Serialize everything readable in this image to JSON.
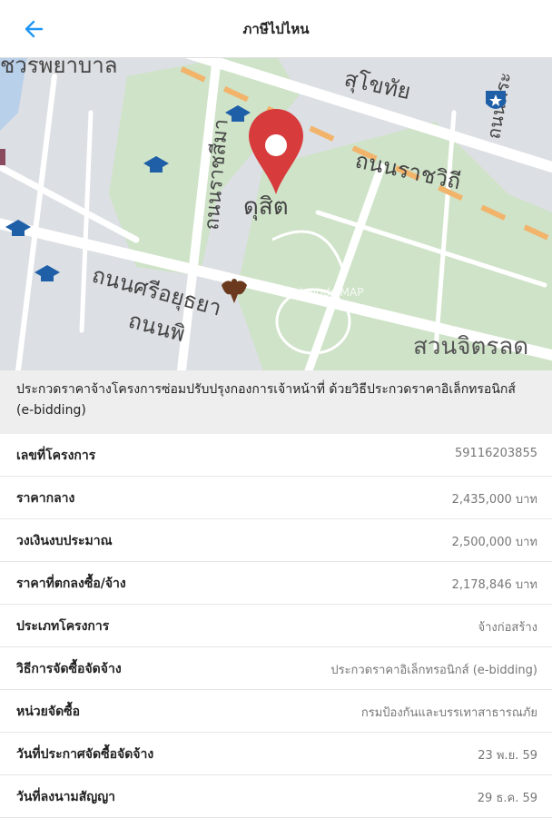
{
  "header": {
    "title": "ภาษีไปไหน",
    "back_icon": "arrow-left-icon",
    "accent_color": "#2196f3"
  },
  "map": {
    "labels": {
      "road_top_left": "ชวรพยาบาล",
      "road_top_right": "สุโขทัย",
      "road_right_vertical": "ถนนพระ",
      "road_center_vertical": "ถนนราชสีมา",
      "road_rajawithi": "ถนนราชวิถี",
      "district": "ดุสิต",
      "road_si_ayutthaya": "ถนนศรีอยุธยา",
      "road_phitsanulok": "ถนนพิ",
      "park": "สวนจิตรลด",
      "watermark": "longdo MAP"
    },
    "marker_color": "#d73b3b",
    "icons": [
      "graduation-cap-icon",
      "police-badge-icon",
      "garuda-emblem-icon",
      "location-pin-icon"
    ]
  },
  "project": {
    "title": "ประกวดราคาจ้างโครงการซ่อมปรับปรุงกองการเจ้าหน้าที่ ด้วยวิธีประกวดราคาอิเล็กทรอนิกส์ (e-bidding)"
  },
  "details": [
    {
      "label": "เลขที่โครงการ",
      "value": "59116203855"
    },
    {
      "label": "ราคากลาง",
      "value": "2,435,000 บาท"
    },
    {
      "label": "วงเงินงบประมาณ",
      "value": "2,500,000 บาท"
    },
    {
      "label": "ราคาที่ตกลงซื้อ/จ้าง",
      "value": "2,178,846 บาท"
    },
    {
      "label": "ประเภทโครงการ",
      "value": "จ้างก่อสร้าง"
    },
    {
      "label": "วิธีการจัดซื้อจัดจ้าง",
      "value": "ประกวดราคาอิเล็กทรอนิกส์ (e-bidding)"
    },
    {
      "label": "หน่วยจัดซื้อ",
      "value": "กรมป้องกันและบรรเทาสาธารณภัย"
    },
    {
      "label": "วันที่ประกาศจัดซื้อจัดจ้าง",
      "value": "23 พ.ย. 59"
    },
    {
      "label": "วันที่ลงนามสัญญา",
      "value": "29 ธ.ค. 59"
    }
  ]
}
